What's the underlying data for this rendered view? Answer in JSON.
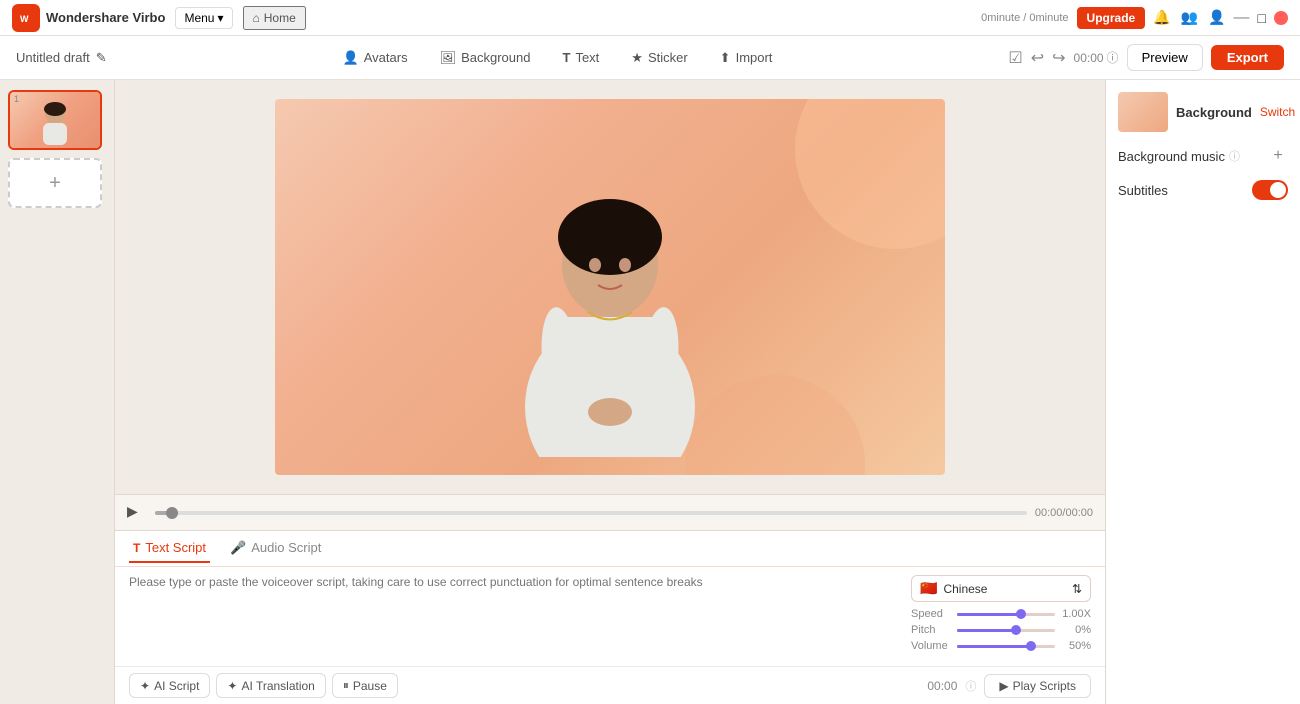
{
  "titleBar": {
    "logoText": "Virbo",
    "logoShort": "W",
    "menuLabel": "Menu",
    "homeLabel": "Home",
    "upgradeLabel": "Upgrade",
    "timeUsage": "0minute / 0minute"
  },
  "topNav": {
    "draftTitle": "Untitled draft",
    "editIcon": "✎",
    "navItems": [
      {
        "id": "avatars",
        "icon": "👤",
        "label": "Avatars"
      },
      {
        "id": "background",
        "icon": "🖼",
        "label": "Background"
      },
      {
        "id": "text",
        "icon": "T",
        "label": "Text"
      },
      {
        "id": "sticker",
        "icon": "★",
        "label": "Sticker"
      },
      {
        "id": "import",
        "icon": "⬆",
        "label": "Import"
      }
    ],
    "timeCounter": "00:00",
    "previewLabel": "Preview",
    "exportLabel": "Export"
  },
  "timeline": {
    "playIcon": "▶",
    "timeDisplay": "00:00/00:00",
    "progressPercent": 2
  },
  "scriptArea": {
    "tabs": [
      {
        "id": "text-script",
        "icon": "T",
        "label": "Text Script",
        "active": true
      },
      {
        "id": "audio-script",
        "icon": "🎤",
        "label": "Audio Script",
        "active": false
      }
    ],
    "placeholder": "Please type or paste the voiceover script, taking care to use correct punctuation for optimal sentence breaks",
    "languageSelector": {
      "flag": "🇨🇳",
      "language": "Chinese",
      "settingsIcon": "⇅"
    },
    "sliders": [
      {
        "label": "Speed",
        "value": "1.00X",
        "fillPercent": 65
      },
      {
        "label": "Pitch",
        "value": "0%",
        "fillPercent": 60
      },
      {
        "label": "Volume",
        "value": "50%",
        "fillPercent": 75
      }
    ],
    "scriptActions": [
      {
        "id": "ai-script",
        "icon": "✦",
        "label": "AI Script"
      },
      {
        "id": "ai-translation",
        "icon": "✦",
        "label": "AI Translation"
      },
      {
        "id": "pause",
        "icon": "⏸",
        "label": "Pause"
      }
    ],
    "scriptTimer": "00:00",
    "playScriptsLabel": "Play Scripts"
  },
  "rightPanel": {
    "bgLabel": "Background",
    "switchLabel": "Switch",
    "bgMusicLabel": "Background music",
    "bgMusicInfoIcon": "ⓘ",
    "addIcon": "+",
    "subtitlesLabel": "Subtitles",
    "subtitlesEnabled": true
  },
  "slide": {
    "number": "1",
    "addSlideIcon": "+"
  }
}
